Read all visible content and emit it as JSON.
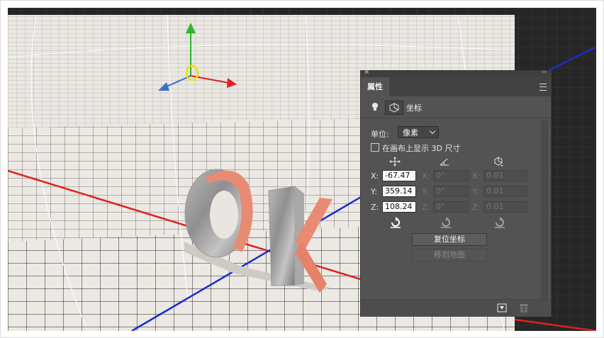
{
  "panel": {
    "tab_label": "属性",
    "subtitle": "坐标",
    "unit_label": "单位:",
    "unit_value": "像素",
    "show_3d_size_label": "在画布上显示 3D 尺寸",
    "reset_button": "复位坐标",
    "move_to_ground_button": "移到地面",
    "position": {
      "x_label": "X:",
      "y_label": "Y:",
      "z_label": "Z:",
      "x": "-67.47",
      "y": "359.14",
      "z": "108.24"
    },
    "rotation": {
      "x_label": "X:",
      "y_label": "Y:",
      "z_label": "Z:",
      "x": "0°",
      "y": "0°",
      "z": "0°"
    },
    "scale": {
      "x_label": "X:",
      "y_label": "Y:",
      "z_label": "Z:",
      "x": "0.01",
      "y": "0.01",
      "z": "0.01"
    }
  },
  "icons": [
    "close-icon",
    "collapse-icon",
    "panel-menu-icon",
    "light-bulb-icon",
    "coordinates-icon",
    "move-icon",
    "rotate-icon",
    "scale-icon",
    "reset-move-icon",
    "reset-rotate-icon",
    "reset-scale-icon",
    "render-icon",
    "trash-icon"
  ],
  "colors": {
    "x_axis": "#e02020",
    "y_axis": "#2db52d",
    "z_axis": "#1a2bd4",
    "ground": "#e8e4df",
    "letter_fill": "#e78a72",
    "panel_bg": "#535353"
  }
}
